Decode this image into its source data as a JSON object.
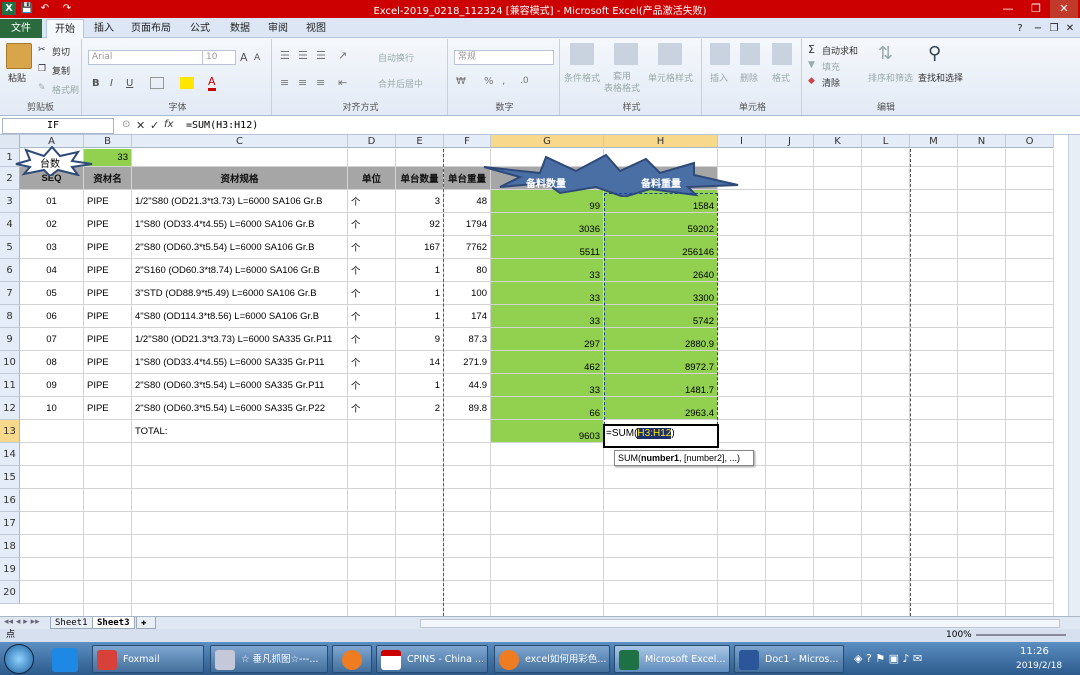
{
  "window": {
    "title": "Excel-2019_0218_112324  [兼容模式] - Microsoft Excel(产品激活失败)",
    "controls": [
      "—",
      "❐",
      "✕"
    ],
    "sub_controls": [
      "−",
      "❐",
      "✕"
    ]
  },
  "quick_access": {
    "app_letter": "X",
    "save": "💾",
    "undo": "↶",
    "redo": "↷"
  },
  "tabs": [
    "文件",
    "开始",
    "插入",
    "页面布局",
    "公式",
    "数据",
    "审阅",
    "视图"
  ],
  "active_tab": "开始",
  "ribbon": {
    "clipboard": {
      "label": "剪贴板",
      "paste": "粘贴",
      "cut": "剪切",
      "copy": "复制",
      "format_painter": "格式刷"
    },
    "font": {
      "label": "字体",
      "font_name": "Arial",
      "font_size": "10",
      "bold": "B",
      "italic": "I",
      "underline": "U",
      "grow": "A",
      "shrink": "A"
    },
    "alignment": {
      "label": "对齐方式",
      "wrap": "自动换行",
      "merge": "合并后居中"
    },
    "number": {
      "label": "数字",
      "format": "常规",
      "percent": "%",
      "comma": ","
    },
    "styles": {
      "label": "样式",
      "conditional": "条件格式",
      "table": "套用\n表格格式",
      "cell_styles": "单元格样式"
    },
    "cells": {
      "label": "单元格",
      "insert": "插入",
      "delete": "删除",
      "format": "格式"
    },
    "editing": {
      "label": "编辑",
      "autosum": "自动求和",
      "fill": "填充",
      "clear": "清除",
      "sort": "排序和筛选",
      "find": "查找和选择"
    }
  },
  "formula_bar": {
    "name_box": "IF",
    "fx": "fx",
    "formula": "=SUM(H3:H12)"
  },
  "columns": [
    "A",
    "B",
    "C",
    "D",
    "E",
    "F",
    "G",
    "H",
    "I",
    "J",
    "K",
    "L",
    "M",
    "N",
    "O"
  ],
  "rows": [
    "1",
    "2",
    "3",
    "4",
    "5",
    "6",
    "7",
    "8",
    "9",
    "10",
    "11",
    "12",
    "13",
    "14",
    "15",
    "16",
    "17",
    "18",
    "19",
    "20"
  ],
  "sheet": {
    "row1": {
      "a": "台数",
      "b": "33"
    },
    "headers": [
      "SEQ",
      "资材名",
      "资材规格",
      "单位",
      "单台数量",
      "单台重量",
      "备料数量",
      "备料重量"
    ],
    "items": [
      {
        "seq": "01",
        "name": "PIPE",
        "spec": "1/2\"S80 (OD21.3*t3.73) L=6000 SA106 Gr.B",
        "unit": "个",
        "qty": "3",
        "wt": "48",
        "tq": "99",
        "tw": "1584"
      },
      {
        "seq": "02",
        "name": "PIPE",
        "spec": "1\"S80 (OD33.4*t4.55) L=6000 SA106 Gr.B",
        "unit": "个",
        "qty": "92",
        "wt": "1794",
        "tq": "3036",
        "tw": "59202"
      },
      {
        "seq": "03",
        "name": "PIPE",
        "spec": "2\"S80 (OD60.3*t5.54) L=6000 SA106 Gr.B",
        "unit": "个",
        "qty": "167",
        "wt": "7762",
        "tq": "5511",
        "tw": "256146"
      },
      {
        "seq": "04",
        "name": "PIPE",
        "spec": "2\"S160 (OD60.3*t8.74) L=6000 SA106 Gr.B",
        "unit": "个",
        "qty": "1",
        "wt": "80",
        "tq": "33",
        "tw": "2640"
      },
      {
        "seq": "05",
        "name": "PIPE",
        "spec": "3\"STD (OD88.9*t5.49) L=6000 SA106 Gr.B",
        "unit": "个",
        "qty": "1",
        "wt": "100",
        "tq": "33",
        "tw": "3300"
      },
      {
        "seq": "06",
        "name": "PIPE",
        "spec": "4\"S80 (OD114.3*t8.56) L=6000 SA106 Gr.B",
        "unit": "个",
        "qty": "1",
        "wt": "174",
        "tq": "33",
        "tw": "5742"
      },
      {
        "seq": "07",
        "name": "PIPE",
        "spec": "1/2\"S80 (OD21.3*t3.73) L=6000 SA335 Gr.P11",
        "unit": "个",
        "qty": "9",
        "wt": "87.3",
        "tq": "297",
        "tw": "2880.9"
      },
      {
        "seq": "08",
        "name": "PIPE",
        "spec": "1\"S80 (OD33.4*t4.55) L=6000 SA335 Gr.P11",
        "unit": "个",
        "qty": "14",
        "wt": "271.9",
        "tq": "462",
        "tw": "8972.7"
      },
      {
        "seq": "09",
        "name": "PIPE",
        "spec": "2\"S80 (OD60.3*t5.54) L=6000 SA335 Gr.P11",
        "unit": "个",
        "qty": "1",
        "wt": "44.9",
        "tq": "33",
        "tw": "1481.7"
      },
      {
        "seq": "10",
        "name": "PIPE",
        "spec": "2\"S80 (OD60.3*t5.54) L=6000 SA335 Gr.P22",
        "unit": "个",
        "qty": "2",
        "wt": "89.8",
        "tq": "66",
        "tw": "2963.4"
      }
    ],
    "total_label": "TOTAL:",
    "total_qty": "9603",
    "editing_prefix": "=SUM(",
    "editing_ref": "H3:H12",
    "editing_suffix": ")",
    "tooltip_fn": "SUM(",
    "tooltip_arg1": "number1",
    "tooltip_rest": ", [number2], ...)"
  },
  "sheet_tabs": [
    "Sheet1",
    "Sheet3"
  ],
  "status": {
    "mode": "点",
    "zoom": "100%"
  },
  "taskbar": {
    "items": [
      "Foxmail",
      "☆ 垂凡抓图☆---...",
      "",
      "CPINS - China ...",
      "excel如何用彩色...",
      "Microsoft Excel...",
      "Doc1 - Micros..."
    ],
    "clock_time": "11:26",
    "clock_date": "2019/2/18"
  },
  "colors": {
    "green_fill": "#92d050",
    "header_fill": "#a6a6a6",
    "title_red": "#cc0000"
  }
}
